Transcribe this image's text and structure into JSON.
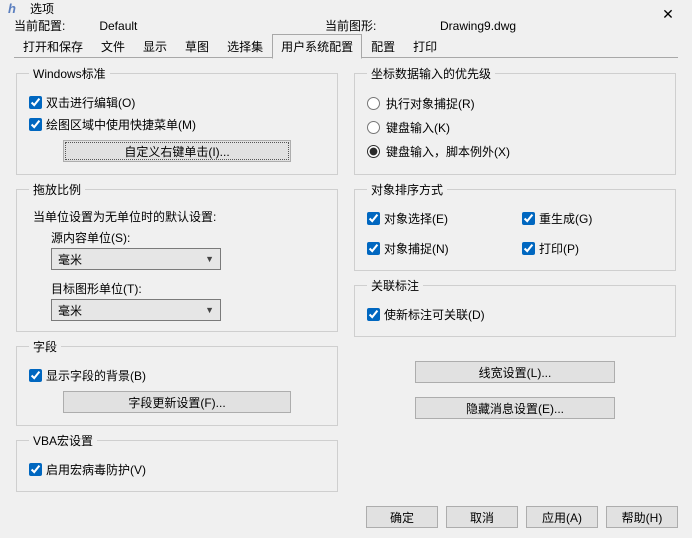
{
  "window": {
    "title": "选项"
  },
  "config": {
    "currentProfileLabel": "当前配置:",
    "currentProfileValue": "Default",
    "currentDrawingLabel": "当前图形:",
    "currentDrawingValue": "Drawing9.dwg"
  },
  "tabs": [
    "打开和保存",
    "文件",
    "显示",
    "草图",
    "选择集",
    "用户系统配置",
    "配置",
    "打印"
  ],
  "activeTab": "用户系统配置",
  "winstd": {
    "legend": "Windows标准",
    "dblclick": "双击进行编辑(O)",
    "contextmenu": "绘图区域中使用快捷菜单(M)",
    "button": "自定义右键单击(I)..."
  },
  "scale": {
    "legend": "拖放比例",
    "desc": "当单位设置为无单位时的默认设置:",
    "srcLabel": "源内容单位(S):",
    "srcValue": "毫米",
    "dstLabel": "目标图形单位(T):",
    "dstValue": "毫米"
  },
  "fields": {
    "legend": "字段",
    "showbg": "显示字段的背景(B)",
    "button": "字段更新设置(F)..."
  },
  "vba": {
    "legend": "VBA宏设置",
    "enable": "启用宏病毒防护(V)"
  },
  "coord": {
    "legend": "坐标数据输入的优先级",
    "r1": "执行对象捕捉(R)",
    "r2": "键盘输入(K)",
    "r3": "键盘输入，脚本例外(X)"
  },
  "sort": {
    "legend": "对象排序方式",
    "c1": "对象选择(E)",
    "c2": "重生成(G)",
    "c3": "对象捕捉(N)",
    "c4": "打印(P)"
  },
  "assoc": {
    "legend": "关联标注",
    "c1": "使新标注可关联(D)"
  },
  "rbuttons": {
    "lw": "线宽设置(L)...",
    "hide": "隐藏消息设置(E)..."
  },
  "footer": {
    "ok": "确定",
    "cancel": "取消",
    "apply": "应用(A)",
    "help": "帮助(H)"
  }
}
